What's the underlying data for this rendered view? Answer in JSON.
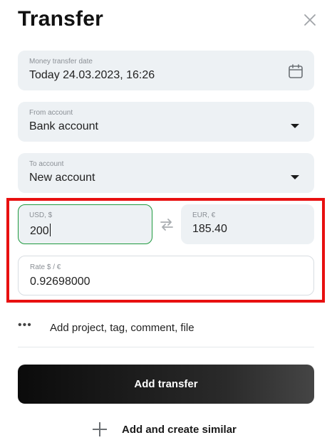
{
  "dialog": {
    "title": "Transfer"
  },
  "date_field": {
    "label": "Money transfer date",
    "value": "Today 24.03.2023, 16:26"
  },
  "from_account": {
    "label": "From account",
    "value": "Bank account"
  },
  "to_account": {
    "label": "To account",
    "value": "New account"
  },
  "amount_from": {
    "label": "USD, $",
    "value": "200"
  },
  "amount_to": {
    "label": "EUR, €",
    "value": "185.40"
  },
  "rate": {
    "label": "Rate  $  /  €",
    "value": "0.92698000"
  },
  "more_options": {
    "dots": "•••",
    "label": "Add project, tag, comment, file"
  },
  "actions": {
    "primary_label": "Add transfer",
    "secondary_label": "Add and create similar"
  },
  "colors": {
    "active_border": "#1f9a3f",
    "field_bg": "#edf1f4",
    "highlight_box": "#e81010",
    "button_bg": "#111111"
  },
  "icons": {
    "close": "close-icon",
    "calendar": "calendar-icon",
    "swap": "swap-icon",
    "plus": "plus-icon"
  }
}
